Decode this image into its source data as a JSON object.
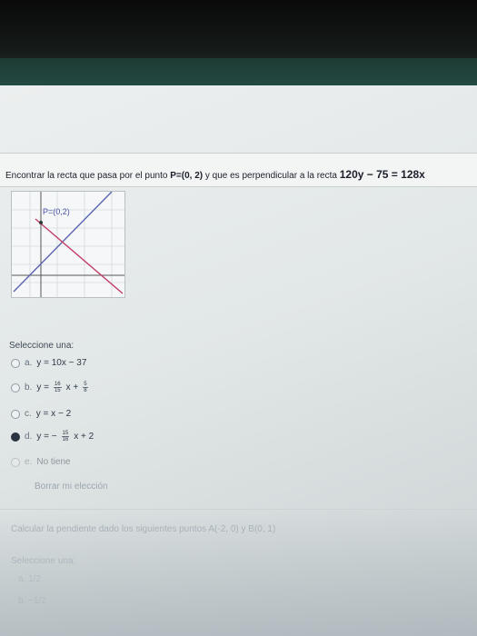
{
  "question1": {
    "prefix": "Encontrar la recta que pasa por el punto ",
    "point": "P=(0, 2)",
    "mid": " y que es perpendicular a la recta ",
    "equation": "120y − 75 = 128x",
    "graph_point_label": "P=(0,2)"
  },
  "select_label": "Seleccione una:",
  "options": [
    {
      "letter": "a.",
      "text": "y = 10x − 37",
      "selected": false
    },
    {
      "letter": "b.",
      "lhs": "y =",
      "num1": "16",
      "den1": "15",
      "mid": "x +",
      "num2": "5",
      "den2": "8",
      "selected": false
    },
    {
      "letter": "c.",
      "text": "y = x − 2",
      "selected": false
    },
    {
      "letter": "d.",
      "lhs": "y = −",
      "num1": "15",
      "den1": "16",
      "tail": "x + 2",
      "selected": true
    },
    {
      "letter": "e.",
      "text": "No tiene",
      "selected": false
    }
  ],
  "reset_label": "Borrar mi elección",
  "question2": {
    "text": "Calcular la pendiente dado los siguientes puntos A(-2, 0) y B(0, 1)",
    "select_label": "Seleccione una:",
    "opt_a": "a. 1/2",
    "opt_b": "b. −1/2"
  }
}
